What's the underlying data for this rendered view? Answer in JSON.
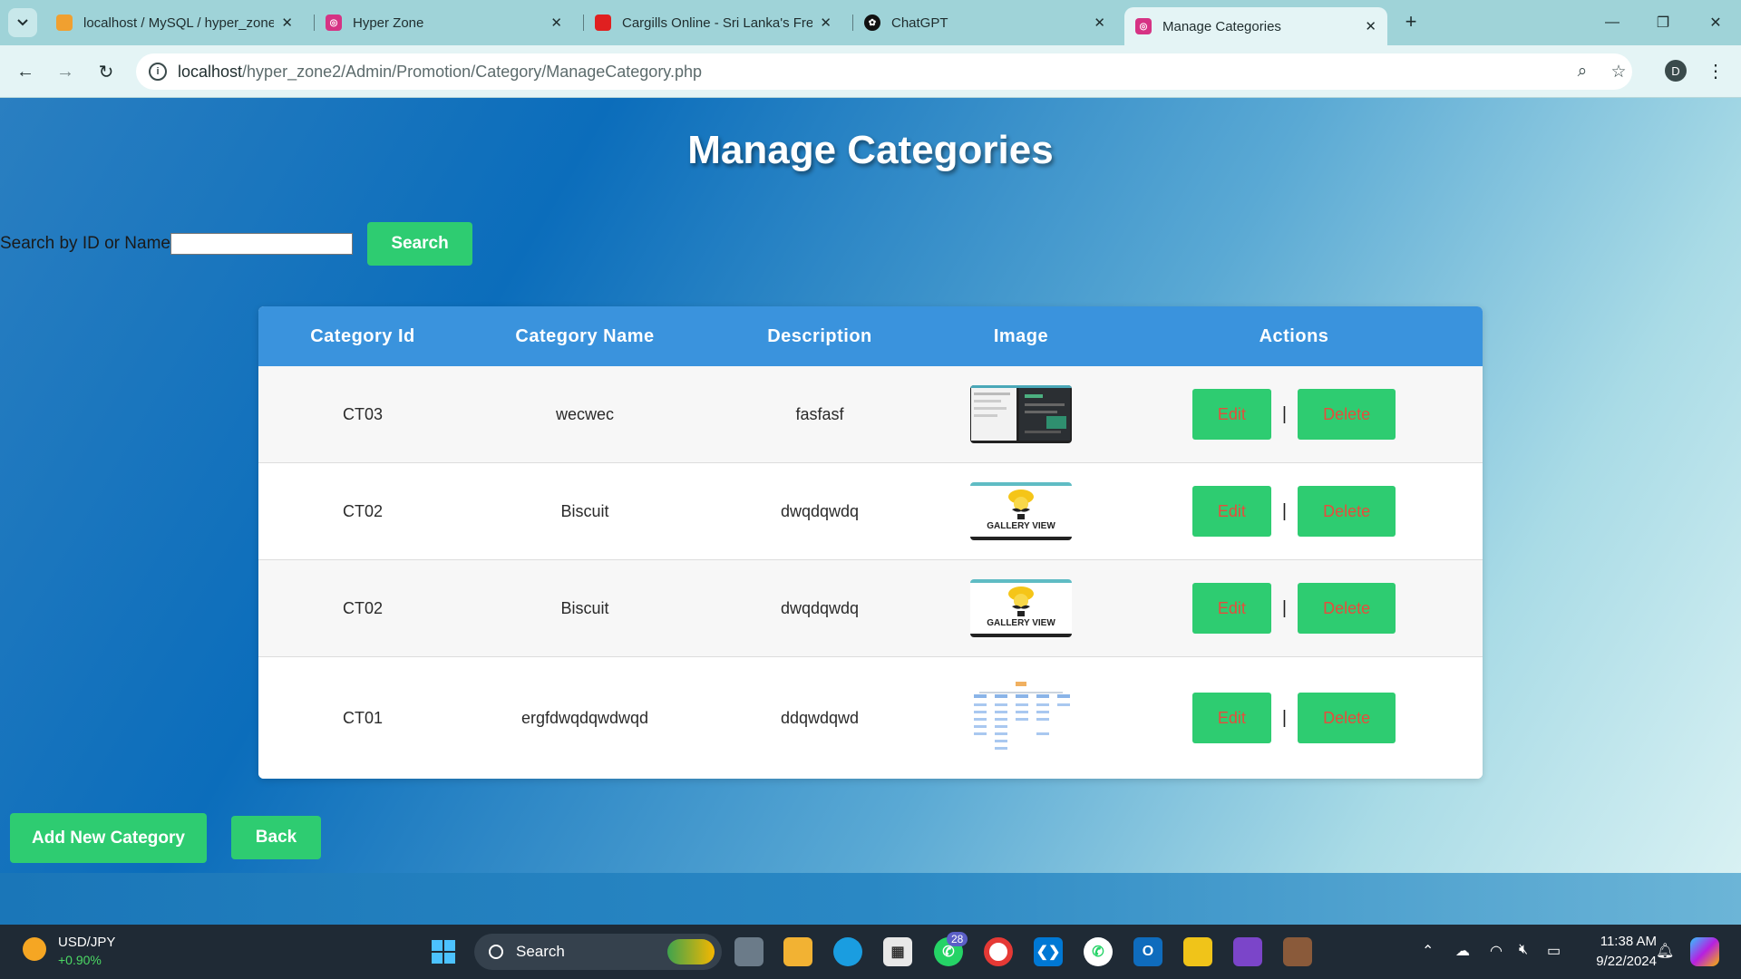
{
  "browser": {
    "tabs": [
      {
        "title": "localhost / MySQL / hyper_zone",
        "favicon_color": "#f0a030"
      },
      {
        "title": "Hyper Zone",
        "favicon_color": "#d63384"
      },
      {
        "title": "Cargills Online - Sri Lanka's Fres",
        "favicon_color": "#e02020"
      },
      {
        "title": "ChatGPT",
        "favicon_color": "#111111"
      },
      {
        "title": "Manage Categories",
        "favicon_color": "#d63384"
      }
    ],
    "new_tab": "+",
    "url_host": "localhost",
    "url_path": "/hyper_zone2/Admin/Promotion/Category/ManageCategory.php",
    "profile_initial": "D"
  },
  "page": {
    "title": "Manage Categories",
    "search_label": "Search by ID or Name:",
    "search_value": "",
    "search_button": "Search",
    "table": {
      "headers": [
        "Category Id",
        "Category Name",
        "Description",
        "Image",
        "Actions"
      ],
      "rows": [
        {
          "id": "CT03",
          "name": "wecwec",
          "description": "fasfasf",
          "image": "screenshot-thumbnail"
        },
        {
          "id": "CT02",
          "name": "Biscuit",
          "description": "dwqdqwdq",
          "image": "gallery-view-logo"
        },
        {
          "id": "CT02",
          "name": "Biscuit",
          "description": "dwqdqwdq",
          "image": "gallery-view-logo"
        },
        {
          "id": "CT01",
          "name": "ergfdwqdqwdwqd",
          "description": "ddqwdqwd",
          "image": "diagram-thumbnail"
        }
      ],
      "edit_label": "Edit",
      "delete_label": "Delete",
      "separator": "|",
      "logo_text": "GALLERY VIEW"
    },
    "add_button": "Add New Category",
    "back_button": "Back"
  },
  "taskbar": {
    "ticker_name": "USD/JPY",
    "ticker_change": "+0.90%",
    "search_placeholder": "Search",
    "whatsapp_badge": "28",
    "time": "11:38 AM",
    "date": "9/22/2024"
  },
  "colors": {
    "accent_green": "#2ecc71",
    "header_blue": "#3a93dd",
    "delete_text": "#e74c3c"
  }
}
